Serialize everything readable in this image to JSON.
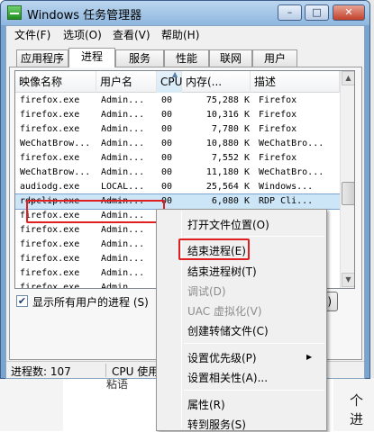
{
  "window": {
    "title": "Windows 任务管理器",
    "min_glyph": "–",
    "max_glyph": "□",
    "close_glyph": "✕"
  },
  "menu": [
    "文件(F)",
    "选项(O)",
    "查看(V)",
    "帮助(H)"
  ],
  "tabs": [
    "应用程序",
    "进程",
    "服务",
    "性能",
    "联网",
    "用户"
  ],
  "active_tab": "进程",
  "columns": [
    "映像名称",
    "用户名",
    "CPU",
    "内存(...",
    "描述"
  ],
  "rows": [
    [
      "firefox.exe",
      "Admin...",
      "00",
      "75,288 K",
      "Firefox"
    ],
    [
      "firefox.exe",
      "Admin...",
      "00",
      "10,316 K",
      "Firefox"
    ],
    [
      "firefox.exe",
      "Admin...",
      "00",
      "7,780 K",
      "Firefox"
    ],
    [
      "WeChatBrow...",
      "Admin...",
      "00",
      "10,880 K",
      "WeChatBro..."
    ],
    [
      "firefox.exe",
      "Admin...",
      "00",
      "7,552 K",
      "Firefox"
    ],
    [
      "WeChatBrow...",
      "Admin...",
      "00",
      "11,180 K",
      "WeChatBro..."
    ],
    [
      "audiodg.exe",
      "LOCAL...",
      "00",
      "25,564 K",
      "Windows..."
    ],
    [
      "rdpclip.exe",
      "Admin...",
      "00",
      "6,080 K",
      "RDP Cli..."
    ],
    [
      "firefox.exe",
      "Admin...",
      "",
      "",
      ""
    ],
    [
      "firefox.exe",
      "Admin...",
      "",
      "",
      ""
    ],
    [
      "firefox.exe",
      "Admin...",
      "",
      "",
      ""
    ],
    [
      "firefox.exe",
      "Admin...",
      "",
      "",
      ""
    ],
    [
      "firefox.exe",
      "Admin...",
      "",
      "",
      ""
    ],
    [
      "firefox.exe",
      "Admin...",
      "",
      "",
      ""
    ]
  ],
  "selected_row": 7,
  "show_all_label": "显示所有用户的进程 (S)",
  "show_all_checked": "✔",
  "end_button_label": "E)",
  "status": {
    "processes": "进程数: 107",
    "cpu": "CPU 使用率"
  },
  "context_menu": {
    "open_location": "打开文件位置(O)",
    "end_process": "结束进程(E)",
    "end_tree": "结束进程树(T)",
    "debug": "调试(D)",
    "uac": "UAC 虚拟化(V)",
    "dump": "创建转储文件(C)",
    "priority": "设置优先级(P)",
    "affinity": "设置相关性(A)...",
    "properties": "属性(R)",
    "goto_service": "转到服务(S)",
    "submenu_arrow": "▶"
  },
  "background": {
    "text1": "粘语",
    "text2": "个进"
  }
}
